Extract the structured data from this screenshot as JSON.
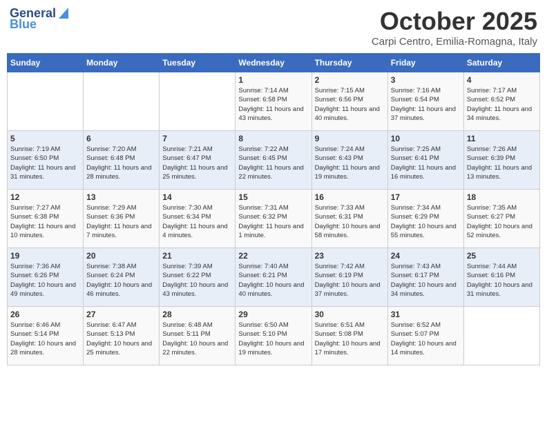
{
  "header": {
    "logo_line1": "General",
    "logo_line2": "Blue",
    "month_title": "October 2025",
    "location": "Carpi Centro, Emilia-Romagna, Italy"
  },
  "days_of_week": [
    "Sunday",
    "Monday",
    "Tuesday",
    "Wednesday",
    "Thursday",
    "Friday",
    "Saturday"
  ],
  "weeks": [
    [
      {
        "day": "",
        "sunrise": "",
        "sunset": "",
        "daylight": ""
      },
      {
        "day": "",
        "sunrise": "",
        "sunset": "",
        "daylight": ""
      },
      {
        "day": "",
        "sunrise": "",
        "sunset": "",
        "daylight": ""
      },
      {
        "day": "1",
        "sunrise": "Sunrise: 7:14 AM",
        "sunset": "Sunset: 6:58 PM",
        "daylight": "Daylight: 11 hours and 43 minutes."
      },
      {
        "day": "2",
        "sunrise": "Sunrise: 7:15 AM",
        "sunset": "Sunset: 6:56 PM",
        "daylight": "Daylight: 11 hours and 40 minutes."
      },
      {
        "day": "3",
        "sunrise": "Sunrise: 7:16 AM",
        "sunset": "Sunset: 6:54 PM",
        "daylight": "Daylight: 11 hours and 37 minutes."
      },
      {
        "day": "4",
        "sunrise": "Sunrise: 7:17 AM",
        "sunset": "Sunset: 6:52 PM",
        "daylight": "Daylight: 11 hours and 34 minutes."
      }
    ],
    [
      {
        "day": "5",
        "sunrise": "Sunrise: 7:19 AM",
        "sunset": "Sunset: 6:50 PM",
        "daylight": "Daylight: 11 hours and 31 minutes."
      },
      {
        "day": "6",
        "sunrise": "Sunrise: 7:20 AM",
        "sunset": "Sunset: 6:48 PM",
        "daylight": "Daylight: 11 hours and 28 minutes."
      },
      {
        "day": "7",
        "sunrise": "Sunrise: 7:21 AM",
        "sunset": "Sunset: 6:47 PM",
        "daylight": "Daylight: 11 hours and 25 minutes."
      },
      {
        "day": "8",
        "sunrise": "Sunrise: 7:22 AM",
        "sunset": "Sunset: 6:45 PM",
        "daylight": "Daylight: 11 hours and 22 minutes."
      },
      {
        "day": "9",
        "sunrise": "Sunrise: 7:24 AM",
        "sunset": "Sunset: 6:43 PM",
        "daylight": "Daylight: 11 hours and 19 minutes."
      },
      {
        "day": "10",
        "sunrise": "Sunrise: 7:25 AM",
        "sunset": "Sunset: 6:41 PM",
        "daylight": "Daylight: 11 hours and 16 minutes."
      },
      {
        "day": "11",
        "sunrise": "Sunrise: 7:26 AM",
        "sunset": "Sunset: 6:39 PM",
        "daylight": "Daylight: 11 hours and 13 minutes."
      }
    ],
    [
      {
        "day": "12",
        "sunrise": "Sunrise: 7:27 AM",
        "sunset": "Sunset: 6:38 PM",
        "daylight": "Daylight: 11 hours and 10 minutes."
      },
      {
        "day": "13",
        "sunrise": "Sunrise: 7:29 AM",
        "sunset": "Sunset: 6:36 PM",
        "daylight": "Daylight: 11 hours and 7 minutes."
      },
      {
        "day": "14",
        "sunrise": "Sunrise: 7:30 AM",
        "sunset": "Sunset: 6:34 PM",
        "daylight": "Daylight: 11 hours and 4 minutes."
      },
      {
        "day": "15",
        "sunrise": "Sunrise: 7:31 AM",
        "sunset": "Sunset: 6:32 PM",
        "daylight": "Daylight: 11 hours and 1 minute."
      },
      {
        "day": "16",
        "sunrise": "Sunrise: 7:33 AM",
        "sunset": "Sunset: 6:31 PM",
        "daylight": "Daylight: 10 hours and 58 minutes."
      },
      {
        "day": "17",
        "sunrise": "Sunrise: 7:34 AM",
        "sunset": "Sunset: 6:29 PM",
        "daylight": "Daylight: 10 hours and 55 minutes."
      },
      {
        "day": "18",
        "sunrise": "Sunrise: 7:35 AM",
        "sunset": "Sunset: 6:27 PM",
        "daylight": "Daylight: 10 hours and 52 minutes."
      }
    ],
    [
      {
        "day": "19",
        "sunrise": "Sunrise: 7:36 AM",
        "sunset": "Sunset: 6:26 PM",
        "daylight": "Daylight: 10 hours and 49 minutes."
      },
      {
        "day": "20",
        "sunrise": "Sunrise: 7:38 AM",
        "sunset": "Sunset: 6:24 PM",
        "daylight": "Daylight: 10 hours and 46 minutes."
      },
      {
        "day": "21",
        "sunrise": "Sunrise: 7:39 AM",
        "sunset": "Sunset: 6:22 PM",
        "daylight": "Daylight: 10 hours and 43 minutes."
      },
      {
        "day": "22",
        "sunrise": "Sunrise: 7:40 AM",
        "sunset": "Sunset: 6:21 PM",
        "daylight": "Daylight: 10 hours and 40 minutes."
      },
      {
        "day": "23",
        "sunrise": "Sunrise: 7:42 AM",
        "sunset": "Sunset: 6:19 PM",
        "daylight": "Daylight: 10 hours and 37 minutes."
      },
      {
        "day": "24",
        "sunrise": "Sunrise: 7:43 AM",
        "sunset": "Sunset: 6:17 PM",
        "daylight": "Daylight: 10 hours and 34 minutes."
      },
      {
        "day": "25",
        "sunrise": "Sunrise: 7:44 AM",
        "sunset": "Sunset: 6:16 PM",
        "daylight": "Daylight: 10 hours and 31 minutes."
      }
    ],
    [
      {
        "day": "26",
        "sunrise": "Sunrise: 6:46 AM",
        "sunset": "Sunset: 5:14 PM",
        "daylight": "Daylight: 10 hours and 28 minutes."
      },
      {
        "day": "27",
        "sunrise": "Sunrise: 6:47 AM",
        "sunset": "Sunset: 5:13 PM",
        "daylight": "Daylight: 10 hours and 25 minutes."
      },
      {
        "day": "28",
        "sunrise": "Sunrise: 6:48 AM",
        "sunset": "Sunset: 5:11 PM",
        "daylight": "Daylight: 10 hours and 22 minutes."
      },
      {
        "day": "29",
        "sunrise": "Sunrise: 6:50 AM",
        "sunset": "Sunset: 5:10 PM",
        "daylight": "Daylight: 10 hours and 19 minutes."
      },
      {
        "day": "30",
        "sunrise": "Sunrise: 6:51 AM",
        "sunset": "Sunset: 5:08 PM",
        "daylight": "Daylight: 10 hours and 17 minutes."
      },
      {
        "day": "31",
        "sunrise": "Sunrise: 6:52 AM",
        "sunset": "Sunset: 5:07 PM",
        "daylight": "Daylight: 10 hours and 14 minutes."
      },
      {
        "day": "",
        "sunrise": "",
        "sunset": "",
        "daylight": ""
      }
    ]
  ]
}
